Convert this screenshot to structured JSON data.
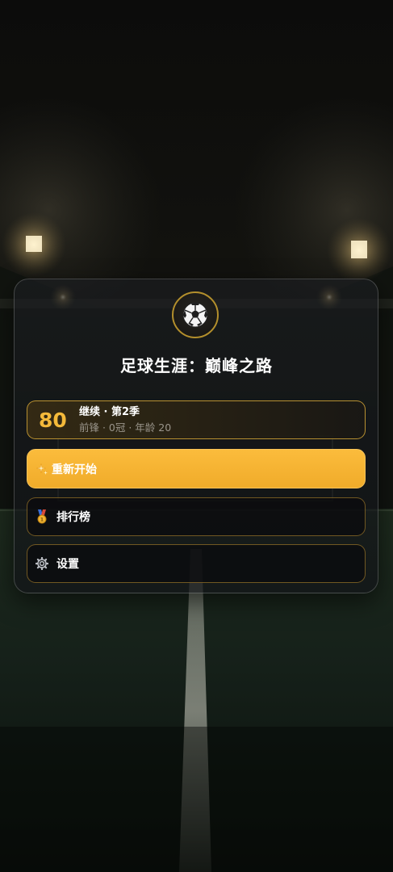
{
  "app": {
    "title": "足球生涯：巅峰之路"
  },
  "continue_card": {
    "rating": "80",
    "label": "继续 · 第2季",
    "details": "前锋 · 0冠 · 年龄 20"
  },
  "menu": {
    "restart": {
      "label": "重新开始",
      "icon": "sparkle-icon"
    },
    "leaderboard": {
      "label": "排行榜",
      "icon": "medal-icon"
    },
    "settings": {
      "label": "设置",
      "icon": "gear-icon"
    }
  },
  "colors": {
    "accent": "#f4b93a",
    "restart_button": "#f5b331",
    "panel_border": "#c49632",
    "background": "#0b0d0c"
  }
}
